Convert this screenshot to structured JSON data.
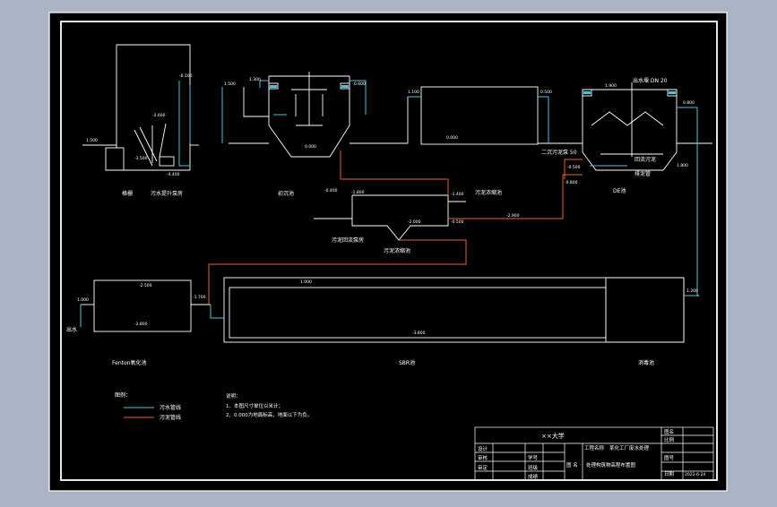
{
  "colors": {
    "background": "#aab4c4",
    "paper": "#000000",
    "line": "#ffffff",
    "water_pipe": "#4fc3d9",
    "sludge_pipe": "#e8623a",
    "titleblock_fill": "#000000"
  },
  "units": {
    "screen_pump": {
      "name": "格栅",
      "name2": "污水提升泵房",
      "levels": [
        "1.500",
        "-2.600",
        "-3.500",
        "-4.400",
        "-6.100"
      ]
    },
    "primary_clarifier": {
      "name": "初沉池",
      "levels": [
        "1.500",
        "1.300",
        "0.600",
        "0.000"
      ]
    },
    "aeration_tank": {
      "name": "",
      "levels": [
        "1.100",
        "0.500",
        "0.000"
      ]
    },
    "secondary_clarifier": {
      "name": "DE池",
      "top_label": "出水堰 DN 20",
      "label_left": "二沉污泥泵 50",
      "label_pipe": "排泥管",
      "label_pipe2": "回流污泥",
      "levels": [
        "0.800",
        "1.800",
        "-0.500",
        "-0.800",
        "1.900"
      ]
    },
    "sludge_tank": {
      "name": "污泥浓缩池",
      "label_pump": "污泥回流泵房",
      "label_out": "污泥浓缩池",
      "levels": [
        "-0.400",
        "-1.800",
        "-1.400",
        "-2.000",
        "-2.900",
        "-0.500"
      ]
    },
    "contact_tank": {
      "name": "Fenton氧化池",
      "levels": [
        "1.000",
        "-2.500",
        "-2.800",
        "-1.700"
      ]
    },
    "sbr_tank": {
      "name": "SBR池",
      "levels": [
        "1.000",
        "-3.800"
      ]
    },
    "outlet_tank": {
      "name": "消毒池",
      "levels": [
        "1.200"
      ]
    },
    "outlet_label": "出水"
  },
  "legend": {
    "title": "图例：",
    "items": [
      {
        "label": "污水管线"
      },
      {
        "label": "污泥管线"
      }
    ]
  },
  "notes": {
    "title": "说明：",
    "lines": [
      "1、本图尺寸单位以米计；",
      "2、0.000为地面标高，地面以下为负。"
    ]
  },
  "title_block": {
    "school": "××大学",
    "project_label": "工程名称",
    "project_value": "某化工厂废水处理",
    "drawing_label": "图名",
    "drawing_value": "处理构筑物高程布置图",
    "scale_label": "比例",
    "sheet_label": "图号",
    "date_label": "日期",
    "date_value": "2022-6-24",
    "rows_left": [
      "设计",
      "审核",
      "审定"
    ],
    "rows_mid": [
      "学号",
      "班级",
      "成绩"
    ],
    "drawn_label": "图 名"
  }
}
